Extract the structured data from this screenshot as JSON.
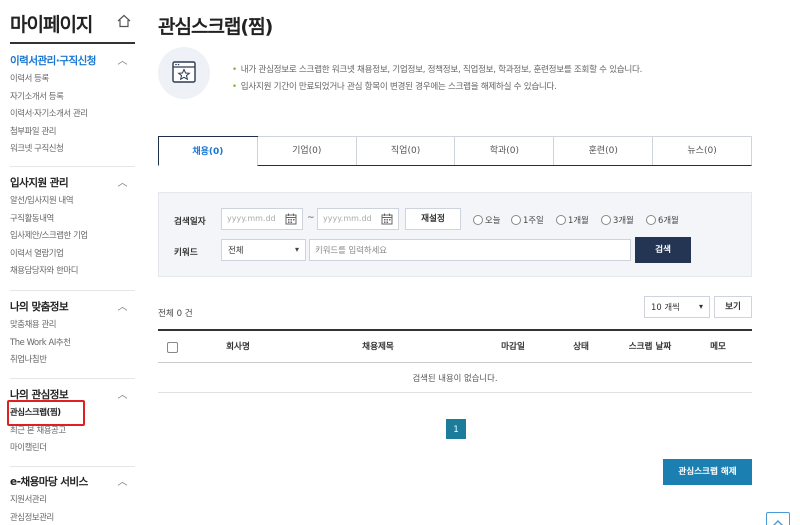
{
  "sidebar": {
    "title": "마이페이지",
    "groups": [
      {
        "heading": "이력서관리·구직신청",
        "items": [
          "이력서 등록",
          "자기소개서 등록",
          "이력서·자기소개서 관리",
          "첨부파일 관리",
          "워크넷 구직신청"
        ]
      },
      {
        "heading": "입사지원 관리",
        "items": [
          "알선/입사지원 내역",
          "구직활동내역",
          "입사제안/스크랩한 기업",
          "이력서 열람기업",
          "채용담당자와 한마디"
        ]
      },
      {
        "heading": "나의 맞춤정보",
        "items": [
          "맞춤채용 관리",
          "The Work AI추천",
          "취업나침반"
        ]
      },
      {
        "heading": "나의 관심정보",
        "items": [
          "관심스크랩(찜)",
          "최근 본 채용공고",
          "마이캘린더"
        ]
      },
      {
        "heading": "e-채용마당 서비스",
        "items": [
          "지원서관리",
          "관심정보관리"
        ]
      }
    ]
  },
  "main": {
    "title": "관심스크랩(찜)",
    "info": [
      "내가 관심정보로 스크랩한 워크넷 채용정보, 기업정보, 정책정보, 직업정보, 학과정보, 훈련정보를 조회할 수 있습니다.",
      "입사지원 기간이 만료되었거나 관심 항목이 변경된 경우에는 스크랩을 해제하실 수 있습니다."
    ],
    "tabs": [
      "채용(0)",
      "기업(0)",
      "직업(0)",
      "학과(0)",
      "훈련(0)",
      "뉴스(0)"
    ],
    "search": {
      "date_label": "검색일자",
      "date_placeholder": "yyyy.mm.dd",
      "tilde": "~",
      "reset": "재설정",
      "ranges": [
        "오늘",
        "1주일",
        "1개월",
        "3개월",
        "6개월"
      ],
      "keyword_label": "키워드",
      "select_value": "전체",
      "keyword_placeholder": "키워드를 입력하세요",
      "search_button": "검색"
    },
    "total_label": "전체",
    "total_count": "0",
    "total_unit": "건",
    "per_page": "10 개씩",
    "view_button": "보기",
    "columns": [
      "회사명",
      "채용제목",
      "마감일",
      "상태",
      "스크랩 날짜",
      "메모"
    ],
    "empty_text": "검색된 내용이 없습니다.",
    "current_page": "1",
    "unscrap_button": "관심스크랩 해제"
  },
  "colors": {
    "accent": "#1976d2",
    "navy": "#243554",
    "teal": "#1c7d9b",
    "highlight": "#e02020"
  }
}
